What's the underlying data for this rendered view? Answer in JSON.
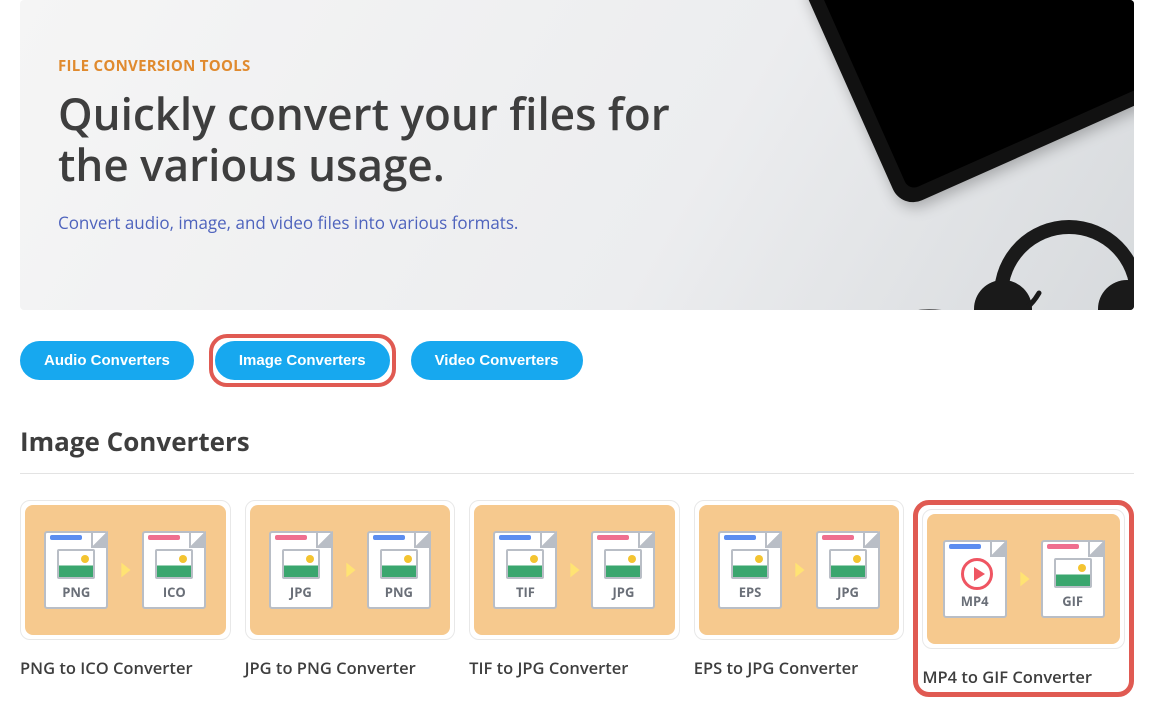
{
  "hero": {
    "eyebrow": "FILE CONVERSION TOOLS",
    "headline": "Quickly convert your files for the various usage.",
    "subline": "Convert audio, image, and video files into various formats."
  },
  "tabs": [
    {
      "label": "Audio Converters",
      "highlight": false
    },
    {
      "label": "Image Converters",
      "highlight": true
    },
    {
      "label": "Video Converters",
      "highlight": false
    }
  ],
  "section_title": "Image Converters",
  "converters": [
    {
      "from": "PNG",
      "to": "ICO",
      "from_bar": "blue",
      "to_bar": "pink",
      "from_kind": "image",
      "to_kind": "image",
      "label": "PNG to ICO Converter",
      "highlight": false
    },
    {
      "from": "JPG",
      "to": "PNG",
      "from_bar": "pink",
      "to_bar": "blue",
      "from_kind": "image",
      "to_kind": "image",
      "label": "JPG to PNG Converter",
      "highlight": false
    },
    {
      "from": "TIF",
      "to": "JPG",
      "from_bar": "blue",
      "to_bar": "pink",
      "from_kind": "image",
      "to_kind": "image",
      "label": "TIF to JPG Converter",
      "highlight": false
    },
    {
      "from": "EPS",
      "to": "JPG",
      "from_bar": "blue",
      "to_bar": "pink",
      "from_kind": "image",
      "to_kind": "image",
      "label": "EPS to JPG Converter",
      "highlight": false
    },
    {
      "from": "MP4",
      "to": "GIF",
      "from_bar": "blue",
      "to_bar": "pink",
      "from_kind": "video",
      "to_kind": "image",
      "label": "MP4 to GIF Converter",
      "highlight": true
    }
  ],
  "dock_colors": [
    "#e14b4b",
    "#f29b2a",
    "#f6d33c",
    "#3da65b",
    "#32b5e8",
    "#6a5bd4",
    "#d1d1d1"
  ]
}
